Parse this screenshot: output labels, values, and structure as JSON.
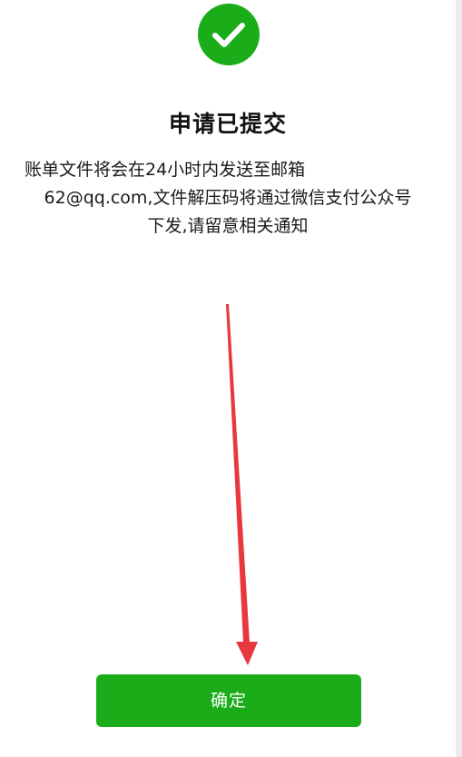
{
  "status": {
    "icon": "checkmark-icon",
    "icon_color": "#1aad19",
    "title": "申请已提交"
  },
  "message": {
    "line1": "账单文件将会在24小时内发送至邮箱",
    "line2": "62@qq.com,文件解压码将通过微信支付公众号",
    "line3": "下发,请留意相关通知"
  },
  "annotation": {
    "type": "arrow",
    "color": "#e8383d",
    "points_to": "confirm-button"
  },
  "actions": {
    "confirm_label": "确定",
    "button_color": "#1aad19"
  }
}
